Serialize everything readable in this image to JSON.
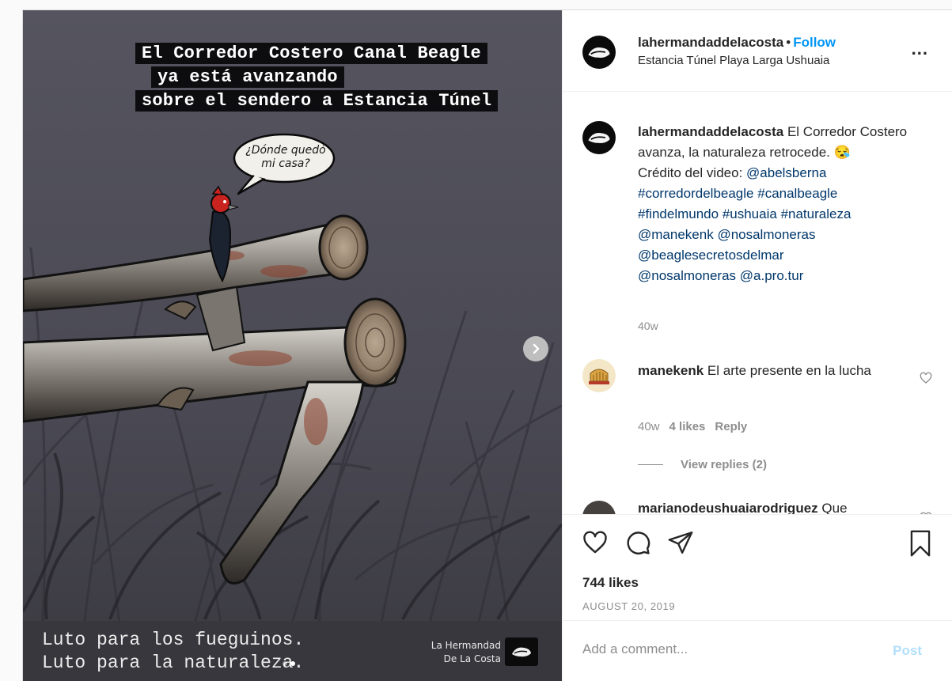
{
  "media": {
    "headline": [
      "El Corredor Costero Canal Beagle",
      "ya está avanzando",
      "sobre el sendero a Estancia Túnel"
    ],
    "speech_bubble": [
      "¿Dónde quedó",
      "mi casa?"
    ],
    "mourning": [
      "Luto para los fueguinos.",
      "Luto para la naturaleza."
    ],
    "brand": [
      "La Hermandad",
      "De La Costa"
    ],
    "next_icon": "chevron-right-icon",
    "carousel_dots": 2,
    "carousel_active": 1
  },
  "header": {
    "username": "lahermandaddelacosta",
    "separator": "•",
    "follow_label": "Follow",
    "location": "Estancia Túnel Playa Larga Ushuaia",
    "more_label": "..."
  },
  "caption": {
    "username": "lahermandaddelacosta",
    "text": " El Corredor Costero avanza, la naturaleza retrocede. 😪",
    "credit_prefix": "Crédito del video: ",
    "credit_handle": "@abelsberna",
    "tags": [
      "#corredordelbeagle",
      "#canalbeagle",
      "#findelmundo",
      "#ushuaia",
      "#naturaleza",
      "@manekenk",
      "@nosalmoneras",
      "@beaglesecretosdelmar",
      "@nosalmoneras",
      "@a.pro.tur"
    ],
    "time": "40w"
  },
  "comments": [
    {
      "username": "manekenk",
      "text": " El arte presente en la lucha",
      "time": "40w",
      "likes": "4 likes",
      "reply_label": "Reply",
      "view_replies": "View replies (2)"
    },
    {
      "username": "marianodeushuaiarodriguez",
      "text": " Que"
    }
  ],
  "actions": {
    "likes": "744 likes",
    "date": "AUGUST 20, 2019"
  },
  "add_comment": {
    "placeholder": "Add a comment...",
    "post_label": "Post"
  },
  "colors": {
    "link": "#00376b",
    "follow": "#0095f6",
    "muted": "#8e8e8e",
    "post_disabled": "#b2dffc",
    "artwork_bg": "#4c4b56"
  }
}
